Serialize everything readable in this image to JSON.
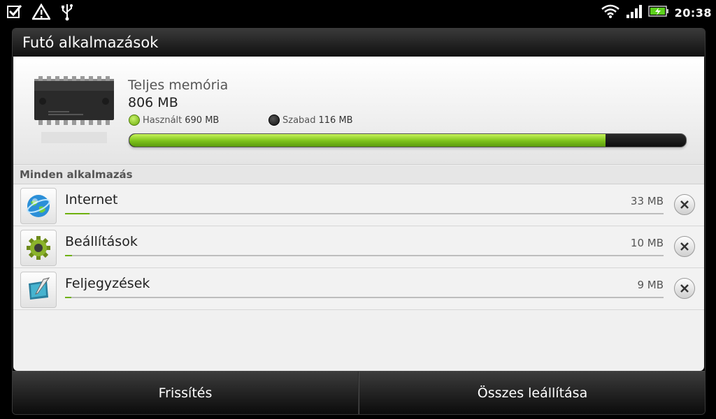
{
  "status_bar": {
    "time": "20:38",
    "left_icons": [
      "checkbox-notification-icon",
      "warning-icon",
      "usb-icon"
    ],
    "right_icons": [
      "wifi-icon",
      "signal-icon",
      "battery-charging-icon"
    ],
    "battery_color": "#5bd01b"
  },
  "dialog": {
    "title": "Futó alkalmazások",
    "memory": {
      "label": "Teljes memória",
      "total": "806 MB",
      "used_label": "Használt",
      "used_value": "690 MB",
      "free_label": "Szabad",
      "free_value": "116 MB",
      "used_fraction": 0.856
    },
    "section_title": "Minden alkalmazás",
    "apps": [
      {
        "name": "Internet",
        "size": "33 MB",
        "fraction": 0.041,
        "icon": "globe-icon"
      },
      {
        "name": "Beállítások",
        "size": "10 MB",
        "fraction": 0.012,
        "icon": "gear-icon"
      },
      {
        "name": "Feljegyzések",
        "size": "9 MB",
        "fraction": 0.011,
        "icon": "notebook-icon"
      }
    ],
    "buttons": {
      "refresh": "Frissítés",
      "stop_all": "Összes leállítása"
    }
  },
  "colors": {
    "accent_green": "#7cc21a",
    "background": "#000000",
    "panel": "#f0f0f0"
  }
}
